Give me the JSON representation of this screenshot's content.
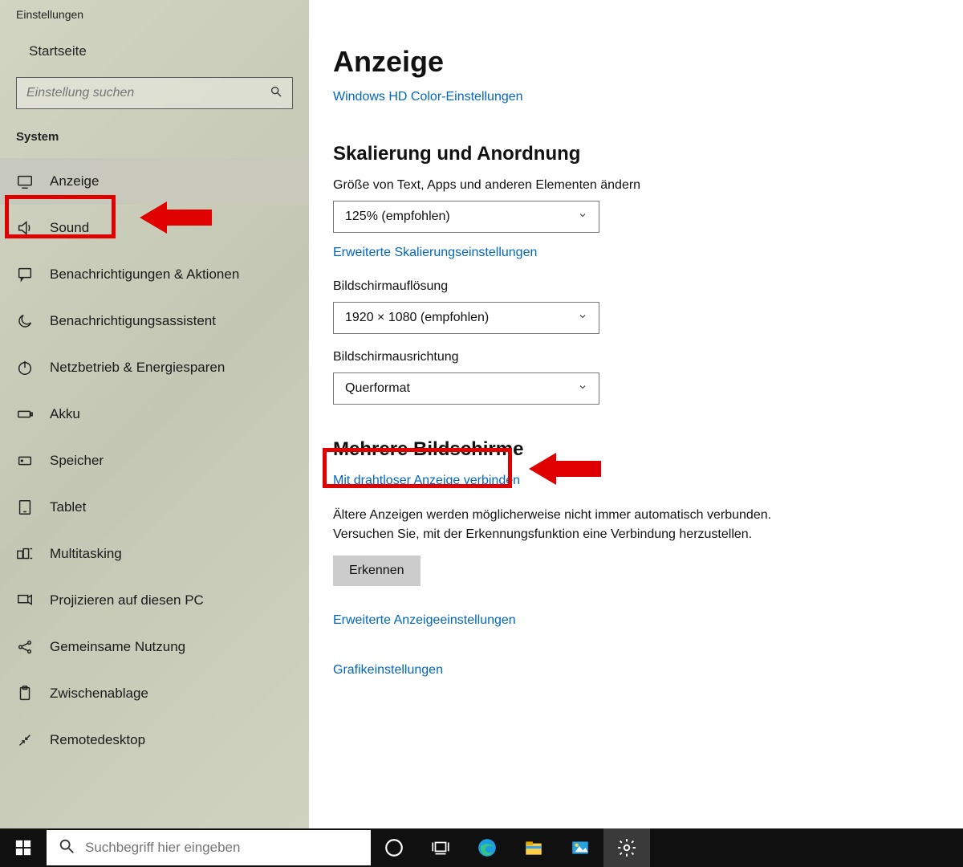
{
  "window": {
    "title": "Einstellungen"
  },
  "sidebar": {
    "home": "Startseite",
    "search_placeholder": "Einstellung suchen",
    "section": "System",
    "items": [
      {
        "label": "Anzeige",
        "icon": "display",
        "active": true
      },
      {
        "label": "Sound",
        "icon": "sound"
      },
      {
        "label": "Benachrichtigungen & Aktionen",
        "icon": "notifications"
      },
      {
        "label": "Benachrichtigungsassistent",
        "icon": "moon"
      },
      {
        "label": "Netzbetrieb & Energiesparen",
        "icon": "power"
      },
      {
        "label": "Akku",
        "icon": "battery"
      },
      {
        "label": "Speicher",
        "icon": "storage"
      },
      {
        "label": "Tablet",
        "icon": "tablet"
      },
      {
        "label": "Multitasking",
        "icon": "multitask"
      },
      {
        "label": "Projizieren auf diesen PC",
        "icon": "project"
      },
      {
        "label": "Gemeinsame Nutzung",
        "icon": "share"
      },
      {
        "label": "Zwischenablage",
        "icon": "clipboard"
      },
      {
        "label": "Remotedesktop",
        "icon": "remote"
      }
    ]
  },
  "main": {
    "title": "Anzeige",
    "hd_color_link": "Windows HD Color-Einstellungen",
    "scaling_heading": "Skalierung und Anordnung",
    "scale_label": "Größe von Text, Apps und anderen Elementen ändern",
    "scale_value": "125% (empfohlen)",
    "advanced_scaling_link": "Erweiterte Skalierungseinstellungen",
    "resolution_label": "Bildschirmauflösung",
    "resolution_value": "1920 × 1080 (empfohlen)",
    "orientation_label": "Bildschirmausrichtung",
    "orientation_value": "Querformat",
    "multi_heading": "Mehrere Bildschirme",
    "wireless_link": "Mit drahtloser Anzeige verbinden",
    "older_text": "Ältere Anzeigen werden möglicherweise nicht immer automatisch verbunden. Versuchen Sie, mit der Erkennungsfunktion eine Verbindung herzustellen.",
    "detect_button": "Erkennen",
    "advanced_display_link": "Erweiterte Anzeigeeinstellungen",
    "graphics_link": "Grafikeinstellungen"
  },
  "taskbar": {
    "search_placeholder": "Suchbegriff hier eingeben"
  },
  "annotations": {
    "nav_highlight": "Anzeige",
    "section_highlight": "Mehrere Bildschirme"
  }
}
